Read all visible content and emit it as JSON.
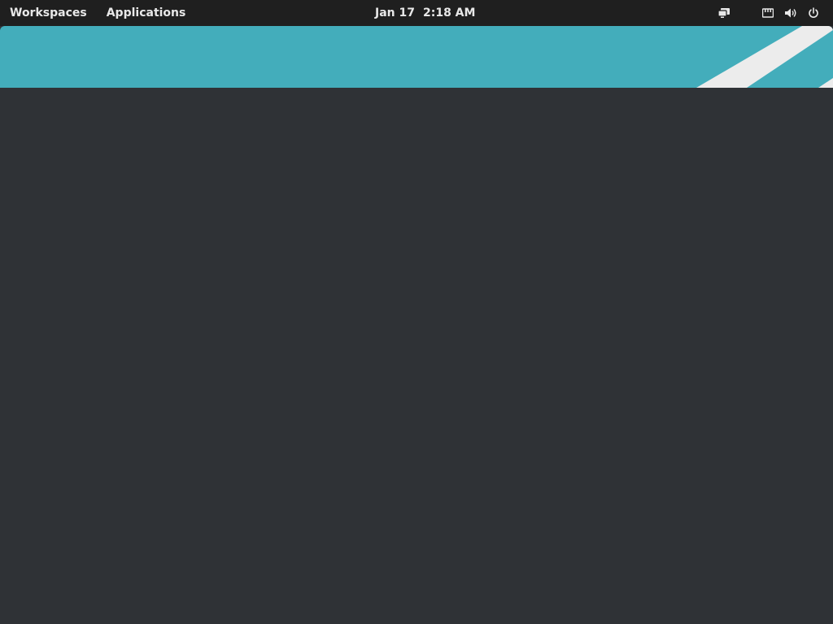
{
  "top_panel": {
    "workspaces_label": "Workspaces",
    "applications_label": "Applications",
    "clock": {
      "date": "Jan 17",
      "time": "2:18 AM"
    },
    "tray_icons": [
      "screen-share-icon",
      "network-wired-icon",
      "volume-icon",
      "power-icon"
    ]
  },
  "colors": {
    "panel_bg": "#1f1f1f",
    "banner_accent": "#43adbb",
    "stripe": "#ececec",
    "desktop_bg": "#2f3236"
  }
}
